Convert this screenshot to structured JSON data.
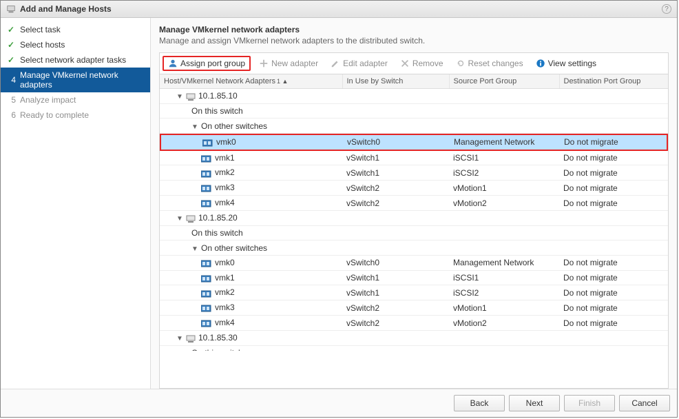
{
  "title": "Add and Manage Hosts",
  "sidebar": {
    "steps": [
      {
        "num": "1",
        "label": "Select task",
        "state": "done"
      },
      {
        "num": "2",
        "label": "Select hosts",
        "state": "done"
      },
      {
        "num": "3",
        "label": "Select network adapter tasks",
        "state": "done"
      },
      {
        "num": "4",
        "label": "Manage VMkernel network adapters",
        "state": "active"
      },
      {
        "num": "5",
        "label": "Analyze impact",
        "state": "inactive"
      },
      {
        "num": "6",
        "label": "Ready to complete",
        "state": "inactive"
      }
    ]
  },
  "main": {
    "heading": "Manage VMkernel network adapters",
    "subheading": "Manage and assign VMkernel network adapters to the distributed switch."
  },
  "toolbar": {
    "assign_port_group": "Assign port group",
    "new_adapter": "New adapter",
    "edit_adapter": "Edit adapter",
    "remove": "Remove",
    "reset_changes": "Reset changes",
    "view_settings": "View settings"
  },
  "columns": {
    "name": "Host/VMkernel Network Adapters",
    "sort_indicator": "1 ▲",
    "in_use": "In Use by Switch",
    "source": "Source Port Group",
    "dest": "Destination Port Group"
  },
  "labels": {
    "on_this_switch": "On this switch",
    "on_other_switches": "On other switches"
  },
  "hosts": [
    {
      "ip": "10.1.85.10",
      "vmks": [
        {
          "name": "vmk0",
          "switch": "vSwitch0",
          "src": "Management Network",
          "dst": "Do not migrate",
          "selected": true
        },
        {
          "name": "vmk1",
          "switch": "vSwitch1",
          "src": "iSCSI1",
          "dst": "Do not migrate"
        },
        {
          "name": "vmk2",
          "switch": "vSwitch1",
          "src": "iSCSI2",
          "dst": "Do not migrate"
        },
        {
          "name": "vmk3",
          "switch": "vSwitch2",
          "src": "vMotion1",
          "dst": "Do not migrate"
        },
        {
          "name": "vmk4",
          "switch": "vSwitch2",
          "src": "vMotion2",
          "dst": "Do not migrate"
        }
      ]
    },
    {
      "ip": "10.1.85.20",
      "vmks": [
        {
          "name": "vmk0",
          "switch": "vSwitch0",
          "src": "Management Network",
          "dst": "Do not migrate"
        },
        {
          "name": "vmk1",
          "switch": "vSwitch1",
          "src": "iSCSI1",
          "dst": "Do not migrate"
        },
        {
          "name": "vmk2",
          "switch": "vSwitch1",
          "src": "iSCSI2",
          "dst": "Do not migrate"
        },
        {
          "name": "vmk3",
          "switch": "vSwitch2",
          "src": "vMotion1",
          "dst": "Do not migrate"
        },
        {
          "name": "vmk4",
          "switch": "vSwitch2",
          "src": "vMotion2",
          "dst": "Do not migrate"
        }
      ]
    },
    {
      "ip": "10.1.85.30",
      "vmks": []
    }
  ],
  "footer": {
    "back": "Back",
    "next": "Next",
    "finish": "Finish",
    "cancel": "Cancel"
  }
}
